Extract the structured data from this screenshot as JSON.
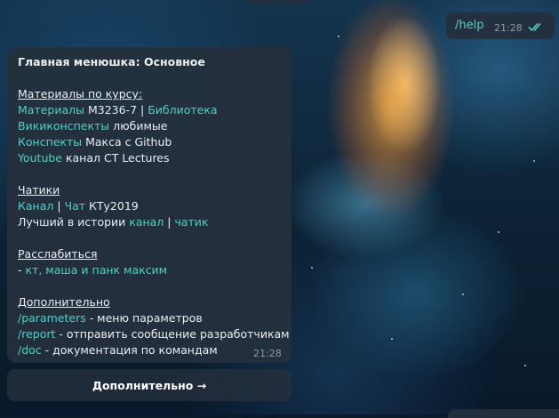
{
  "outgoing": {
    "text": "/help",
    "time": "21:28"
  },
  "incoming": {
    "title": "Главная менюшка: Основное",
    "materials": {
      "heading": "Материалы по курсу:",
      "line1": {
        "link1": "Материалы",
        "text": " M3236-7 | ",
        "link2": "Библиотека"
      },
      "line2": {
        "link": "Викиконспекты",
        "text": " любимые"
      },
      "line3": {
        "link": "Конспекты",
        "text": " Макса с Github"
      },
      "line4": {
        "link": "Youtube",
        "text": " канал CT Lectures"
      }
    },
    "chats": {
      "heading": "Чатики",
      "line1": {
        "link1": "Канал",
        "sep": " | ",
        "link2": "Чат",
        "text": " КТу2019"
      },
      "line2": {
        "text": "Лучший в истории ",
        "link1": "канал",
        "sep": " | ",
        "link2": "чатик"
      }
    },
    "relax": {
      "heading": "Расслабиться",
      "prefix": "- ",
      "link": "кт, маша и панк максим"
    },
    "extra": {
      "heading": "Дополнительно",
      "cmd1": {
        "link": "/parameters",
        "text": " - меню параметров"
      },
      "cmd2": {
        "link": "/report",
        "text": " - отправить сообщение разработчикам"
      },
      "cmd3": {
        "link": "/doc",
        "text": " - документация по командам"
      }
    },
    "time": "21:28"
  },
  "keyboard": {
    "button_label": "Дополнительно →"
  },
  "colors": {
    "link": "#4fd1c5",
    "bubble": "#242f3d",
    "text": "#e9eef3",
    "meta": "#8a9aa9"
  },
  "icons": {
    "read_status": "double-check-icon"
  }
}
